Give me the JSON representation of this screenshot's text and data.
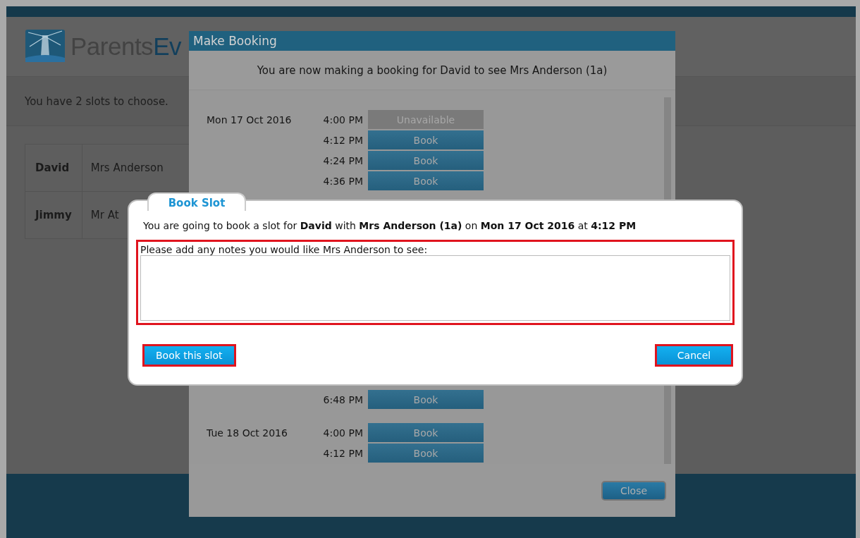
{
  "page": {
    "logo": {
      "first": "Parents",
      "second": "Ev"
    },
    "notice": "You have 2 slots to choose.",
    "students": [
      {
        "name": "David",
        "teacher": "Mrs Anderson"
      },
      {
        "name": "Jimmy",
        "teacher": "Mr At"
      }
    ]
  },
  "booking_modal": {
    "title": "Make Booking",
    "intro": "You are now making a booking for David to see Mrs Anderson (1a)",
    "slots_top": [
      {
        "date": "Mon 17 Oct 2016",
        "time": "4:00 PM",
        "action": "Unavailable",
        "available": false
      },
      {
        "time": "4:12 PM",
        "action": "Book",
        "available": true
      },
      {
        "time": "4:24 PM",
        "action": "Book",
        "available": true
      },
      {
        "time": "4:36 PM",
        "action": "Book",
        "available": true
      }
    ],
    "slots_bottom": [
      {
        "time": "6:48 PM",
        "action": "Book",
        "available": true
      },
      {
        "date": "Tue 18 Oct 2016",
        "time": "4:00 PM",
        "action": "Book",
        "available": true
      },
      {
        "time": "4:12 PM",
        "action": "Book",
        "available": true
      }
    ],
    "close": "Close"
  },
  "book_slot_dialog": {
    "tab": "Book Slot",
    "message": "You are going to book a slot for **David** with **Mrs Anderson (1a)** on **Mon 17 Oct 2016** at **4:12 PM**",
    "notes_label": "Please add any notes you would like Mrs Anderson to see:",
    "confirm": "Book this slot",
    "cancel": "Cancel"
  }
}
